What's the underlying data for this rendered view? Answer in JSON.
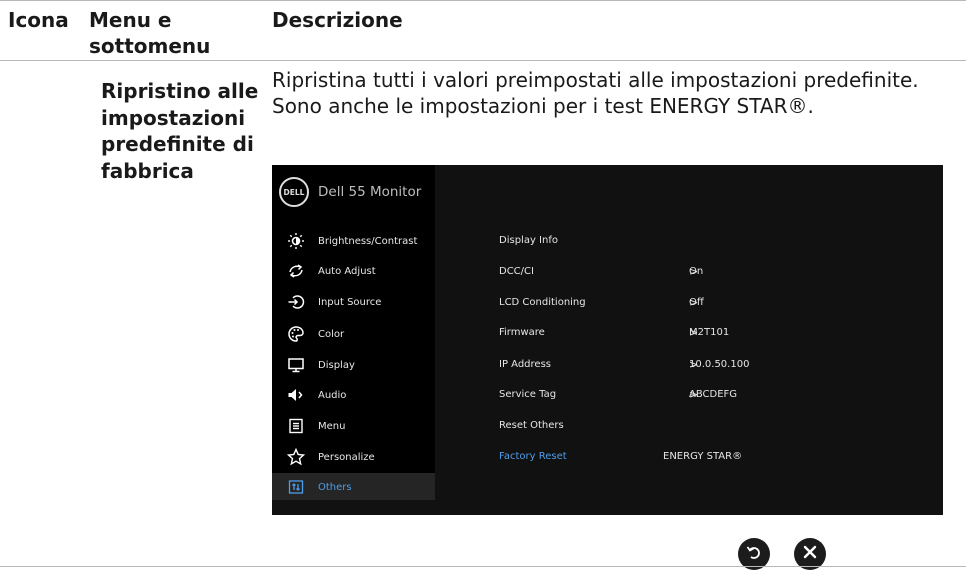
{
  "header": {
    "col_icon": "Icona",
    "col_menu": "Menu e\nsottomenu",
    "col_desc": "Descrizione"
  },
  "row": {
    "label": "Ripristino alle impostazioni predefinite di fabbrica",
    "description": "Ripristina tutti i valori preimpostati alle impostazioni predefinite. Sono anche le impostazioni per i test ENERGY STAR®."
  },
  "osd": {
    "logo_text": "DELL",
    "model": "Dell 55 Monitor",
    "menu": [
      {
        "label": "Brightness/Contrast",
        "icon": "brightness-icon"
      },
      {
        "label": "Auto Adjust",
        "icon": "auto-adjust-icon"
      },
      {
        "label": "Input Source",
        "icon": "input-source-icon"
      },
      {
        "label": "Color",
        "icon": "color-palette-icon"
      },
      {
        "label": "Display",
        "icon": "display-icon"
      },
      {
        "label": "Audio",
        "icon": "speaker-icon"
      },
      {
        "label": "Menu",
        "icon": "menu-icon"
      },
      {
        "label": "Personalize",
        "icon": "star-icon"
      },
      {
        "label": "Others",
        "icon": "others-icon",
        "selected": true
      }
    ],
    "options": [
      {
        "label": "Display Info",
        "value": ""
      },
      {
        "label": "DCC/CI",
        "value": "On",
        "chevron": ">"
      },
      {
        "label": "LCD Conditioning",
        "value": "Off",
        "chevron": ">"
      },
      {
        "label": "Firmware",
        "value": "M2T101",
        "chevron": ">"
      },
      {
        "label": "IP Address",
        "value": "10.0.50.100",
        "chevron": ">"
      },
      {
        "label": "Service Tag",
        "value": "ABCDEFG",
        "chevron": ">"
      },
      {
        "label": "Reset Others",
        "value": ""
      },
      {
        "label": "Factory Reset",
        "value": "ENERGY STAR®",
        "selected": true
      }
    ],
    "colors": {
      "background": "#111111",
      "sidebar": "#000000",
      "accent": "#4f9de8",
      "text": "#e6e6e6"
    }
  },
  "buttons": {
    "back_icon": "back-icon",
    "close_icon": "close-icon"
  }
}
